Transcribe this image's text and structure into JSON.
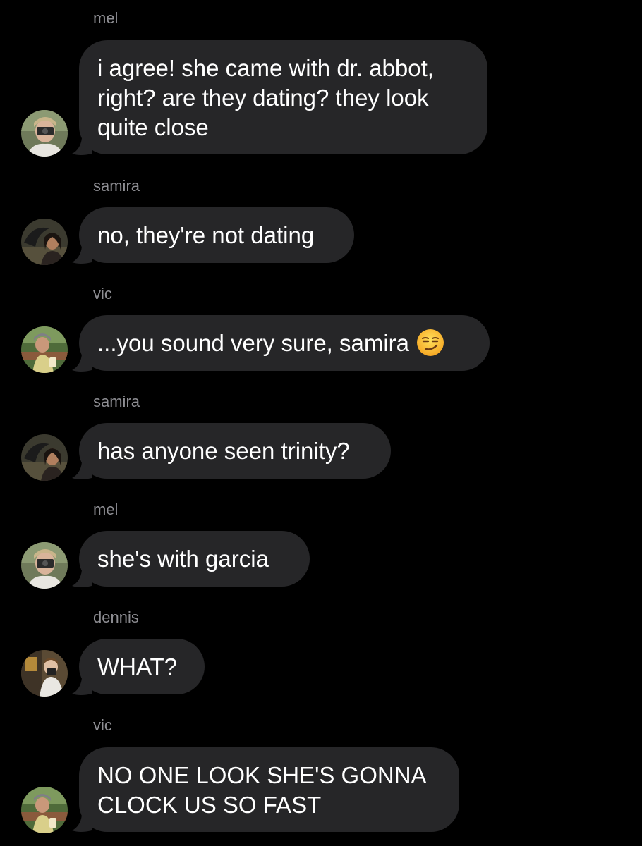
{
  "conversation": {
    "messages": [
      {
        "sender": "mel",
        "text": "i agree! she came with dr. abbot, right? are they dating? they look quite close",
        "avatar": "mel-avatar"
      },
      {
        "sender": "samira",
        "text": "no, they're not dating",
        "avatar": "samira-avatar"
      },
      {
        "sender": "vic",
        "text": "...you sound very sure, samira",
        "emoji": "smirking-face-icon",
        "avatar": "vic-avatar"
      },
      {
        "sender": "samira",
        "text": "has anyone seen trinity?",
        "avatar": "samira-avatar"
      },
      {
        "sender": "mel",
        "text": "she's with garcia",
        "avatar": "mel-avatar"
      },
      {
        "sender": "dennis",
        "text": "WHAT?",
        "avatar": "dennis-avatar"
      },
      {
        "sender": "vic",
        "text": "NO ONE LOOK SHE'S GONNA CLOCK US SO FAST",
        "avatar": "vic-avatar"
      }
    ]
  },
  "colors": {
    "background": "#000000",
    "bubble": "#262628",
    "sender_text": "#8e8e93",
    "message_text": "#ffffff"
  }
}
